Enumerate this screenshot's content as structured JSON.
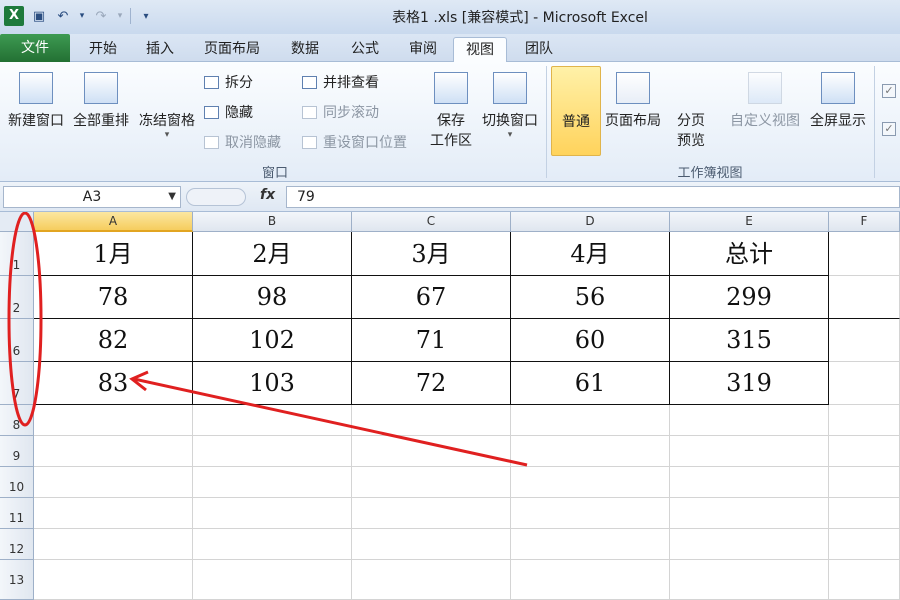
{
  "window": {
    "title": "表格1 .xls  [兼容模式] - Microsoft Excel"
  },
  "qat": {
    "logo": "X",
    "save_icon": "save-icon",
    "undo_icon": "undo-icon",
    "redo_icon": "redo-icon"
  },
  "tabs": [
    "文件",
    "开始",
    "插入",
    "页面布局",
    "数据",
    "公式",
    "审阅",
    "视图",
    "团队"
  ],
  "ribbon": {
    "window_group": {
      "new_window": "新建窗口",
      "arrange_all": "全部重排",
      "freeze_panes": "冻结窗格",
      "split": "拆分",
      "hide": "隐藏",
      "unhide": "取消隐藏",
      "view_side_by_side": "并排查看",
      "sync_scroll": "同步滚动",
      "reset_position": "重设窗口位置",
      "save_workspace_1": "保存",
      "save_workspace_2": "工作区",
      "switch_window": "切换窗口",
      "label": "窗口"
    },
    "workbook_views": {
      "normal": "普通",
      "page_layout": "页面布局",
      "page_break_1": "分页",
      "page_break_2": "预览",
      "custom_views": "自定义视图",
      "full_screen": "全屏显示",
      "label": "工作簿视图"
    }
  },
  "formula_bar": {
    "name_box": "A3",
    "fx": "fx",
    "value": "79"
  },
  "sheet": {
    "columns": [
      "A",
      "B",
      "C",
      "D",
      "E",
      "F"
    ],
    "row_numbers": [
      "1",
      "2",
      "6",
      "7",
      "8",
      "9",
      "10",
      "11",
      "12",
      "13"
    ],
    "rows": [
      [
        "1月",
        "2月",
        "3月",
        "4月",
        "总计"
      ],
      [
        "78",
        "98",
        "67",
        "56",
        "299"
      ],
      [
        "82",
        "102",
        "71",
        "60",
        "315"
      ],
      [
        "83",
        "103",
        "72",
        "61",
        "319"
      ]
    ]
  },
  "annotation": {
    "color": "#e02020"
  }
}
